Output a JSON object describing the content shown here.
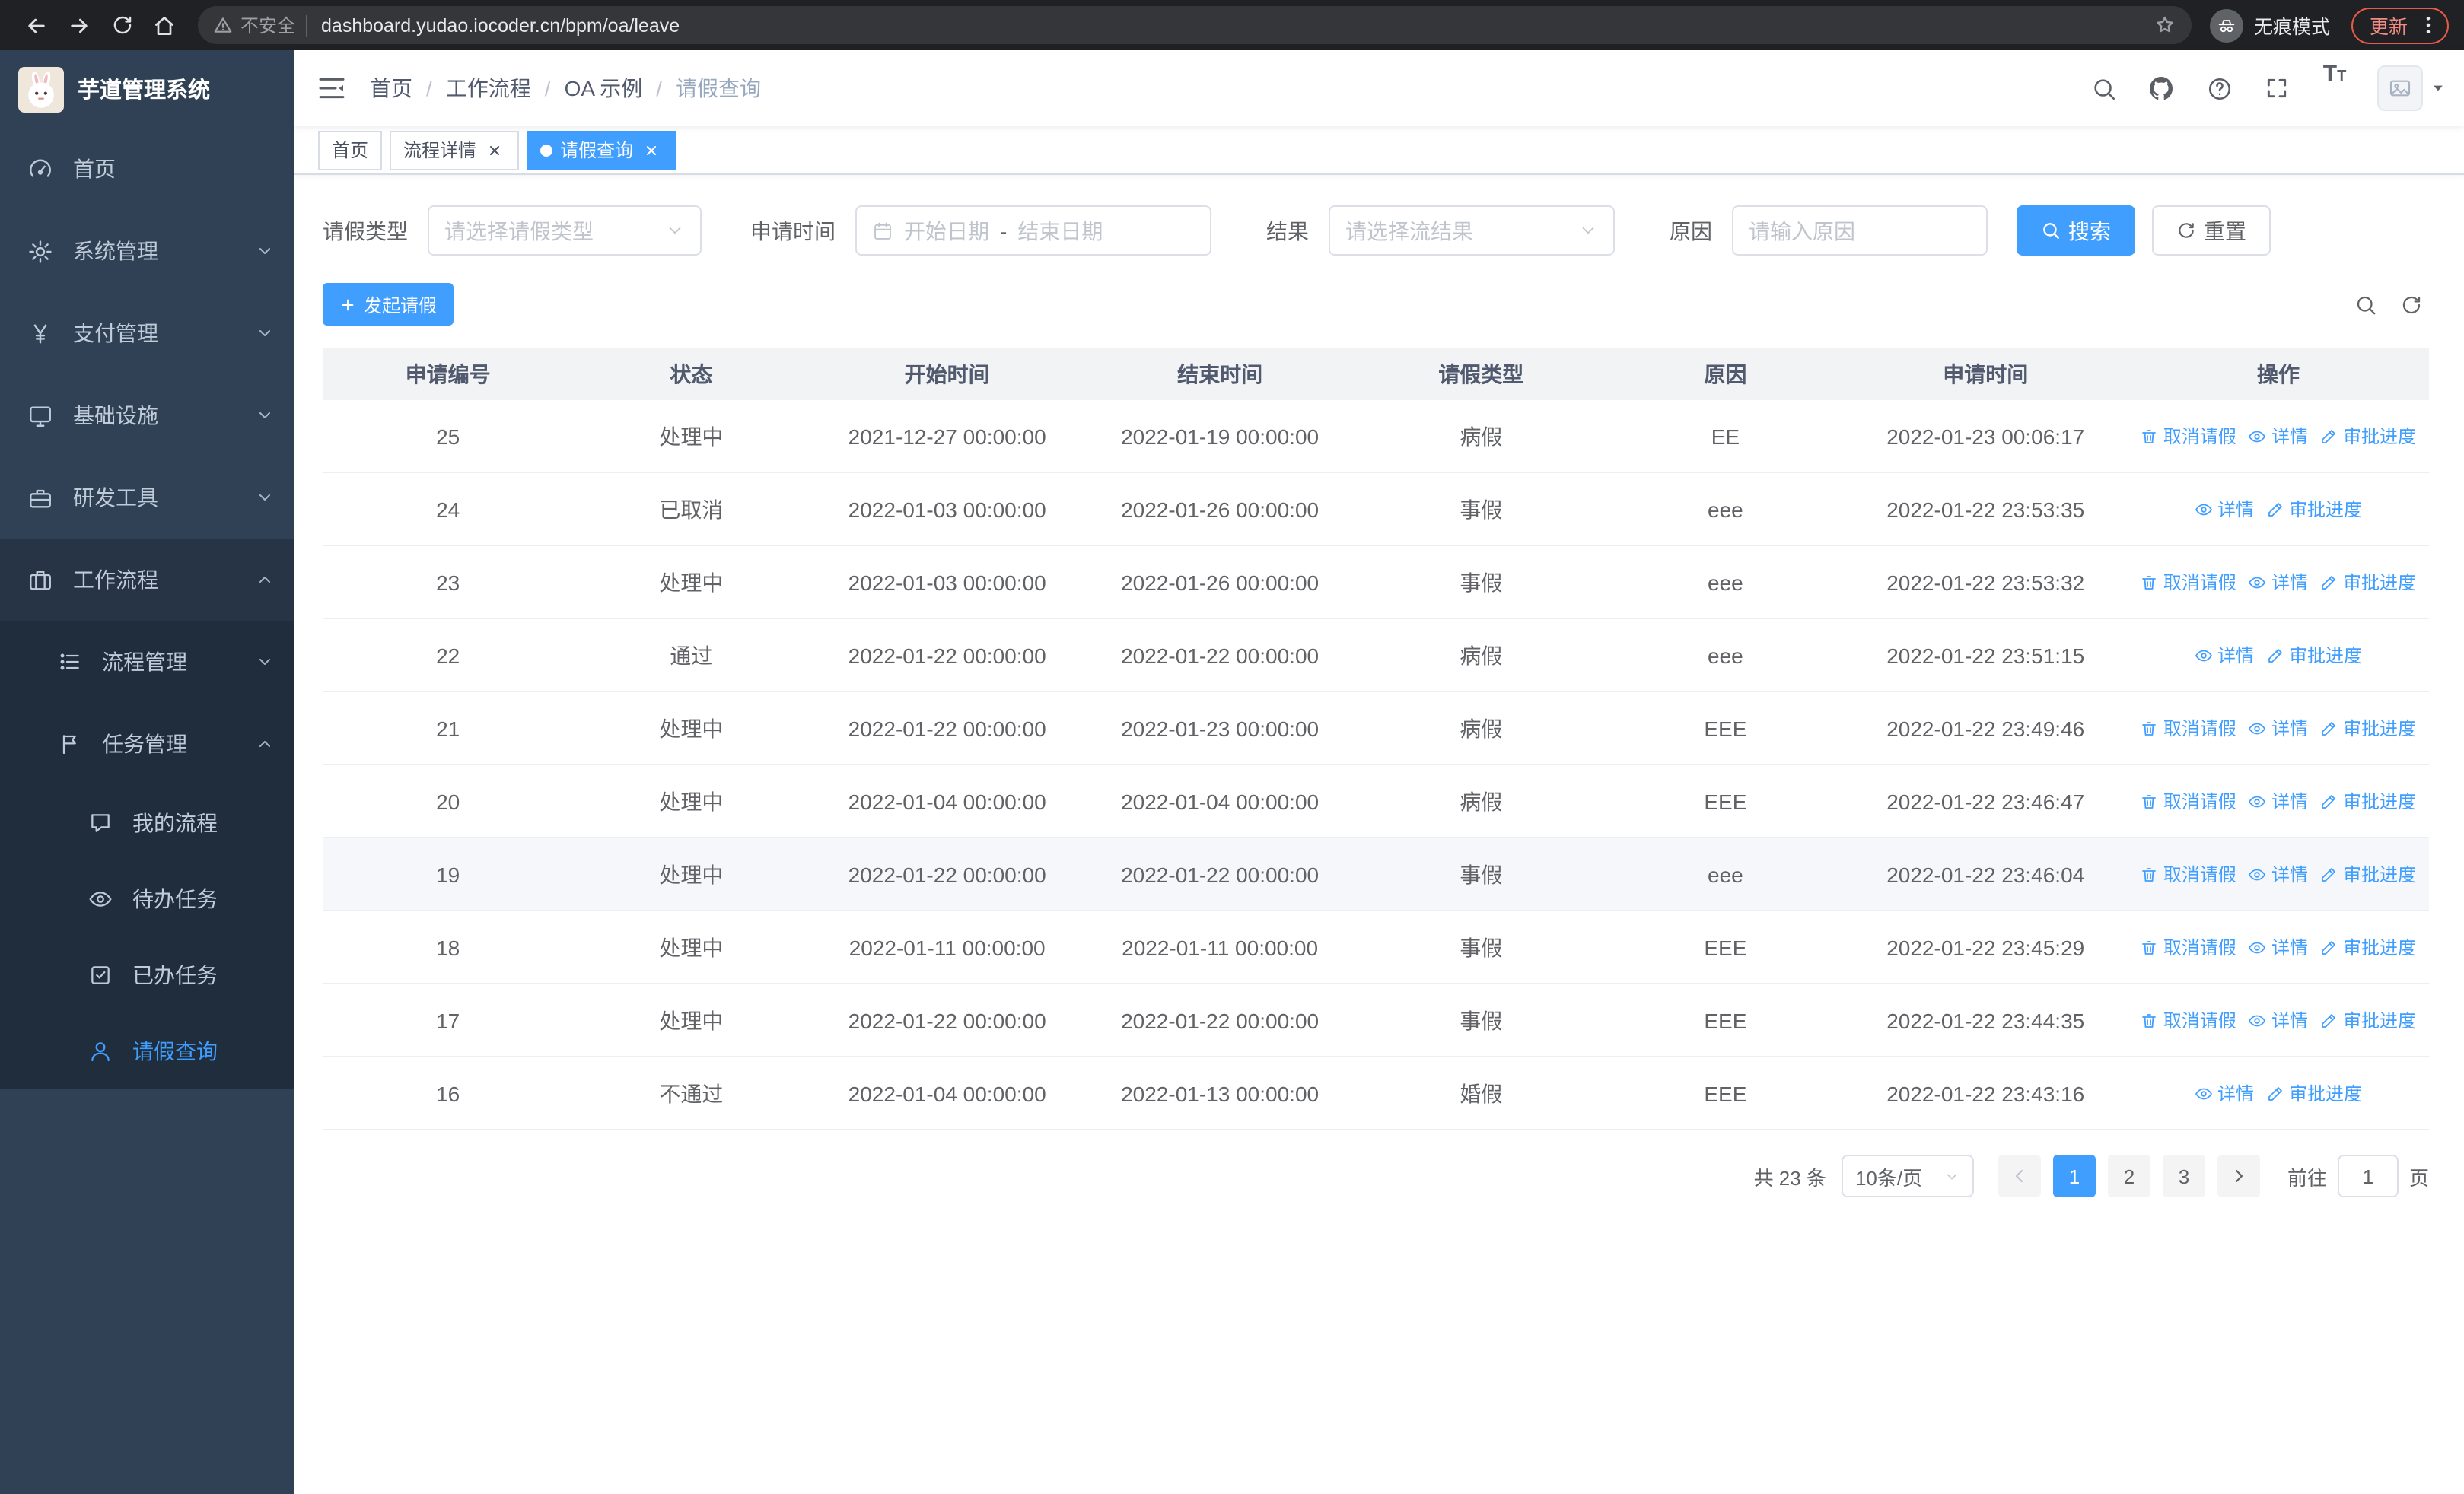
{
  "browser": {
    "security_label": "不安全",
    "url": "dashboard.yudao.iocoder.cn/bpm/oa/leave",
    "incognito_label": "无痕模式",
    "update_label": "更新"
  },
  "sidebar": {
    "title": "芋道管理系统",
    "menu": {
      "home": "首页",
      "system": "系统管理",
      "payment": "支付管理",
      "infra": "基础设施",
      "dev_tools": "研发工具",
      "workflow": "工作流程",
      "process_mgmt": "流程管理",
      "task_mgmt": "任务管理",
      "my_process": "我的流程",
      "todo_tasks": "待办任务",
      "done_tasks": "已办任务",
      "leave_query": "请假查询"
    }
  },
  "header": {
    "breadcrumb": [
      "首页",
      "工作流程",
      "OA 示例",
      "请假查询"
    ],
    "separator": "/",
    "tools": [
      "search",
      "github",
      "help",
      "fullscreen",
      "font-size",
      "avatar"
    ]
  },
  "tabs": [
    {
      "label": "首页",
      "active": false,
      "closable": false
    },
    {
      "label": "流程详情",
      "active": false,
      "closable": true
    },
    {
      "label": "请假查询",
      "active": true,
      "closable": true
    }
  ],
  "filters": {
    "leave_type_label": "请假类型",
    "leave_type_placeholder": "请选择请假类型",
    "apply_time_label": "申请时间",
    "start_date_placeholder": "开始日期",
    "range_separator": "-",
    "end_date_placeholder": "结束日期",
    "result_label": "结果",
    "result_placeholder": "请选择流结果",
    "reason_label": "原因",
    "reason_placeholder": "请输入原因",
    "search_button": "搜索",
    "reset_button": "重置"
  },
  "toolbar": {
    "create_button": "发起请假"
  },
  "table": {
    "columns": [
      "申请编号",
      "状态",
      "开始时间",
      "结束时间",
      "请假类型",
      "原因",
      "申请时间",
      "操作"
    ],
    "actions": {
      "cancel": "取消请假",
      "detail": "详情",
      "progress": "审批进度"
    },
    "rows": [
      {
        "id": "25",
        "status": "处理中",
        "start": "2021-12-27 00:00:00",
        "end": "2022-01-19 00:00:00",
        "type": "病假",
        "reason": "EE",
        "apply_time": "2022-01-23 00:06:17",
        "can_cancel": true,
        "highlight": false
      },
      {
        "id": "24",
        "status": "已取消",
        "start": "2022-01-03 00:00:00",
        "end": "2022-01-26 00:00:00",
        "type": "事假",
        "reason": "eee",
        "apply_time": "2022-01-22 23:53:35",
        "can_cancel": false,
        "highlight": false
      },
      {
        "id": "23",
        "status": "处理中",
        "start": "2022-01-03 00:00:00",
        "end": "2022-01-26 00:00:00",
        "type": "事假",
        "reason": "eee",
        "apply_time": "2022-01-22 23:53:32",
        "can_cancel": true,
        "highlight": false
      },
      {
        "id": "22",
        "status": "通过",
        "start": "2022-01-22 00:00:00",
        "end": "2022-01-22 00:00:00",
        "type": "病假",
        "reason": "eee",
        "apply_time": "2022-01-22 23:51:15",
        "can_cancel": false,
        "highlight": false
      },
      {
        "id": "21",
        "status": "处理中",
        "start": "2022-01-22 00:00:00",
        "end": "2022-01-23 00:00:00",
        "type": "病假",
        "reason": "EEE",
        "apply_time": "2022-01-22 23:49:46",
        "can_cancel": true,
        "highlight": false
      },
      {
        "id": "20",
        "status": "处理中",
        "start": "2022-01-04 00:00:00",
        "end": "2022-01-04 00:00:00",
        "type": "病假",
        "reason": "EEE",
        "apply_time": "2022-01-22 23:46:47",
        "can_cancel": true,
        "highlight": false
      },
      {
        "id": "19",
        "status": "处理中",
        "start": "2022-01-22 00:00:00",
        "end": "2022-01-22 00:00:00",
        "type": "事假",
        "reason": "eee",
        "apply_time": "2022-01-22 23:46:04",
        "can_cancel": true,
        "highlight": true
      },
      {
        "id": "18",
        "status": "处理中",
        "start": "2022-01-11 00:00:00",
        "end": "2022-01-11 00:00:00",
        "type": "事假",
        "reason": "EEE",
        "apply_time": "2022-01-22 23:45:29",
        "can_cancel": true,
        "highlight": false
      },
      {
        "id": "17",
        "status": "处理中",
        "start": "2022-01-22 00:00:00",
        "end": "2022-01-22 00:00:00",
        "type": "事假",
        "reason": "EEE",
        "apply_time": "2022-01-22 23:44:35",
        "can_cancel": true,
        "highlight": false
      },
      {
        "id": "16",
        "status": "不通过",
        "start": "2022-01-04 00:00:00",
        "end": "2022-01-13 00:00:00",
        "type": "婚假",
        "reason": "EEE",
        "apply_time": "2022-01-22 23:43:16",
        "can_cancel": false,
        "highlight": false
      }
    ]
  },
  "pagination": {
    "total_text": "共 23 条",
    "page_size": "10条/页",
    "pages": [
      {
        "num": "1",
        "active": true
      },
      {
        "num": "2",
        "active": false
      },
      {
        "num": "3",
        "active": false
      }
    ],
    "goto_label": "前往",
    "goto_value": "1",
    "page_unit": "页"
  },
  "colors": {
    "primary": "#409EFF",
    "sidebar_bg": "#304156",
    "sidebar_sub_bg": "#1f2d3d",
    "table_header_bg": "#f2f3f5",
    "chrome_bg": "#202124"
  }
}
